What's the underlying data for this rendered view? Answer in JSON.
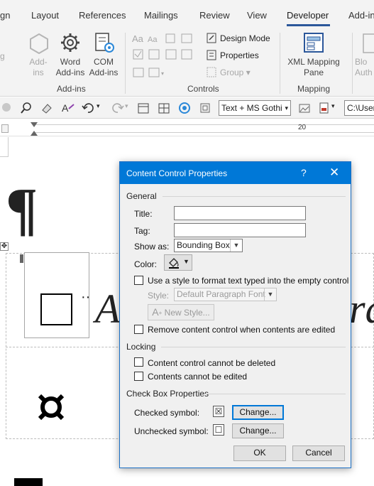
{
  "ribbon_tabs": [
    "gn",
    "Layout",
    "References",
    "Mailings",
    "Review",
    "View",
    "Developer",
    "Add-in"
  ],
  "active_tab": "Developer",
  "ribbon": {
    "addins": {
      "addins_label_1": "Add-",
      "addins_label_2": "ins",
      "word_label_1": "Word",
      "word_label_2": "Add-ins",
      "com_label_1": "COM",
      "com_label_2": "Add-ins",
      "group_name": "Add-ins"
    },
    "controls": {
      "design_mode": "Design Mode",
      "properties": "Properties",
      "group": "Group",
      "group_name": "Controls"
    },
    "mapping": {
      "xml_label_1": "XML Mapping",
      "xml_label_2": "Pane",
      "group_name": "Mapping"
    },
    "right_cut_1": "Blo",
    "right_cut_2": "Auth"
  },
  "toolbar": {
    "font_combo": "Text + MS Gothi",
    "path_combo": "C:\\User"
  },
  "ruler": {
    "mark": "20"
  },
  "document": {
    "pilcrow": "¶",
    "italic_text_left": "A",
    "italic_text_right": "ra"
  },
  "dialog": {
    "title": "Content Control Properties",
    "help": "?",
    "close": "✕",
    "general": "General",
    "title_label": "Title:",
    "title_value": "",
    "tag_label": "Tag:",
    "tag_value": "",
    "show_as_label": "Show as:",
    "show_as_value": "Bounding Box",
    "color_label": "Color:",
    "use_style_label": "Use a style to format text typed into the empty control",
    "style_label": "Style:",
    "style_value": "Default Paragraph Font",
    "new_style": "New Style...",
    "remove_label": "Remove content control when contents are edited",
    "locking": "Locking",
    "lock_delete": "Content control cannot be deleted",
    "lock_edit": "Contents cannot be edited",
    "checkbox_props": "Check Box Properties",
    "checked_symbol_label": "Checked symbol:",
    "checked_symbol": "☒",
    "unchecked_symbol_label": "Unchecked symbol:",
    "unchecked_symbol": "☐",
    "change1": "Change...",
    "change2": "Change...",
    "ok": "OK",
    "cancel": "Cancel"
  }
}
